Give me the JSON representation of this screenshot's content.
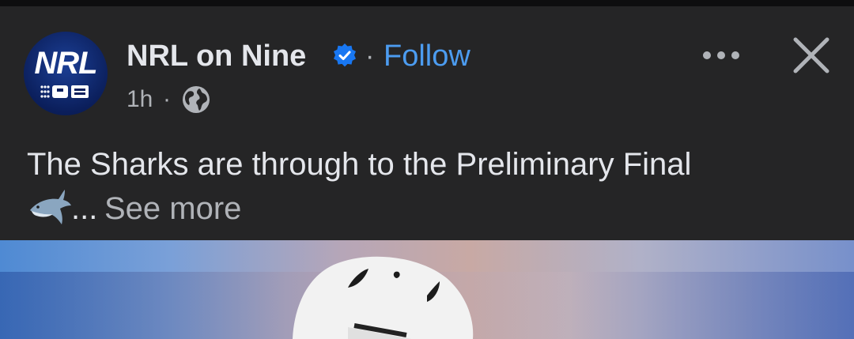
{
  "post": {
    "page_name": "NRL on Nine",
    "separator": "·",
    "follow_label": "Follow",
    "time": "1h",
    "time_separator": "·",
    "text_line1": "The Sharks are through to the Preliminary Final",
    "ellipsis": "...",
    "see_more_label": "See more"
  },
  "avatar": {
    "logo_text": "NRL"
  },
  "colors": {
    "background": "#252526",
    "accent": "#4c9cf0",
    "verified": "#1877f2",
    "text_primary": "#e4e6eb",
    "text_secondary": "#b0b3b8"
  },
  "icons": [
    "verified-badge-icon",
    "globe-icon",
    "more-options-icon",
    "close-icon",
    "shark-emoji"
  ]
}
